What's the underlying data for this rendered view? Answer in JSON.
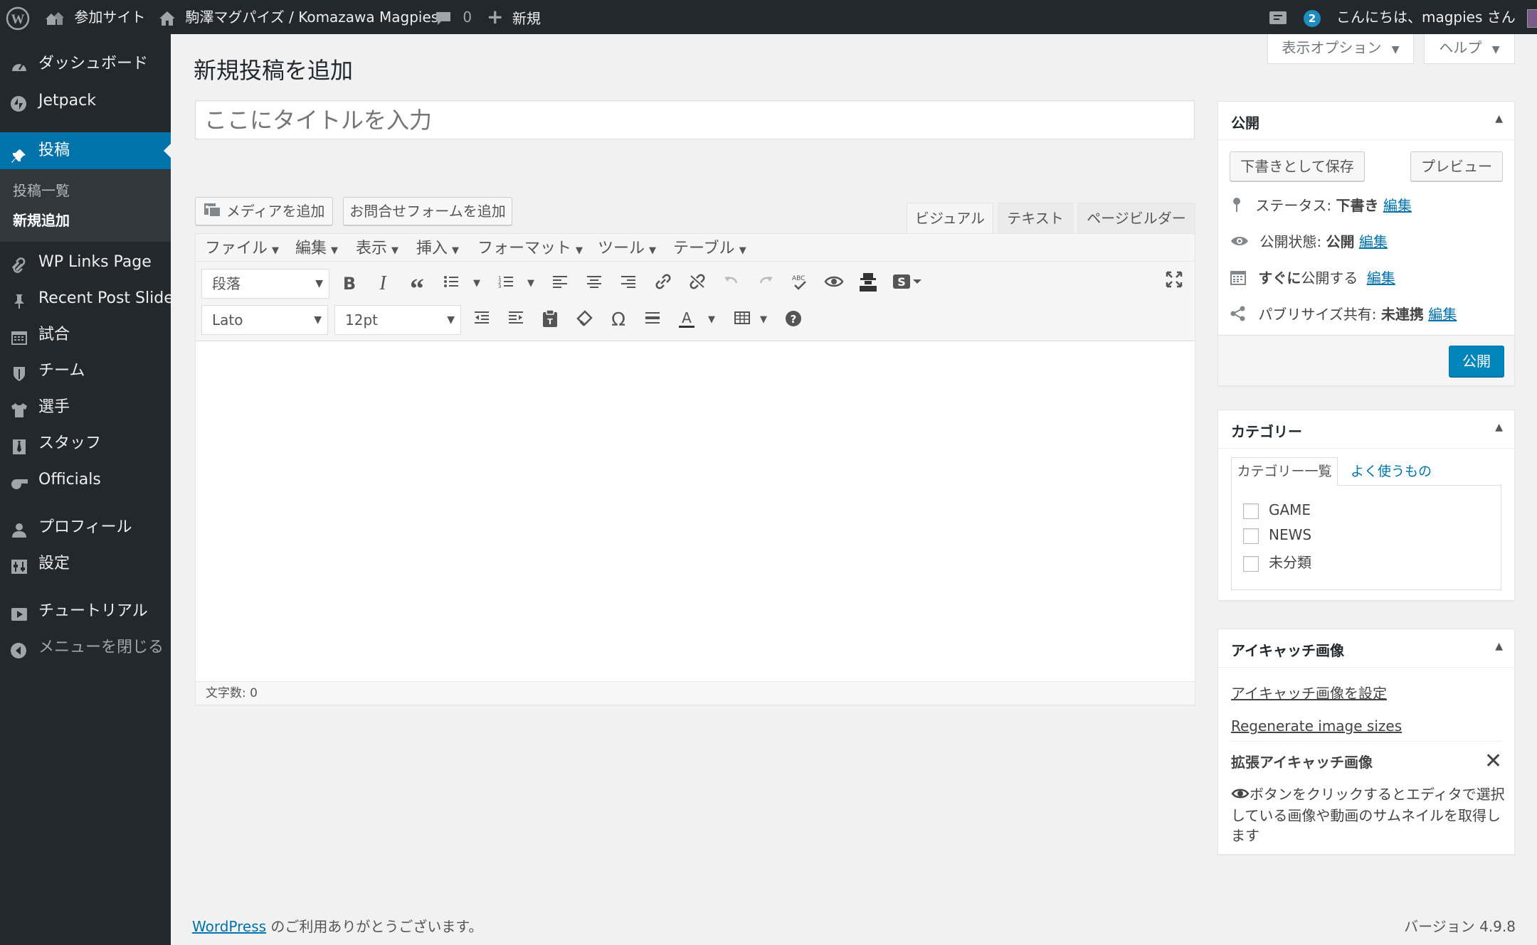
{
  "adminbar": {
    "site_name": "参加サイト",
    "site_title": "駒澤マグパイズ / Komazawa Magpies",
    "comments_count": "0",
    "new_label": "新規",
    "updates_count": "2",
    "greeting": "こんにちは、magpies さん"
  },
  "sidebar": {
    "items": [
      {
        "label": "ダッシュボード",
        "icon": "dashboard-icon"
      },
      {
        "label": "Jetpack",
        "icon": "jetpack-icon"
      },
      {
        "label": "投稿",
        "icon": "pin-icon"
      },
      {
        "label": "WP Links Page",
        "icon": "link-icon"
      },
      {
        "label": "Recent Post Slider",
        "icon": "pin-icon"
      },
      {
        "label": "試合",
        "icon": "calendar-icon"
      },
      {
        "label": "チーム",
        "icon": "shield-icon"
      },
      {
        "label": "選手",
        "icon": "shirt-icon"
      },
      {
        "label": "スタッフ",
        "icon": "tie-icon"
      },
      {
        "label": "Officials",
        "icon": "whistle-icon"
      },
      {
        "label": "プロフィール",
        "icon": "user-icon"
      },
      {
        "label": "設定",
        "icon": "settings-icon"
      },
      {
        "label": "チュートリアル",
        "icon": "video-icon"
      },
      {
        "label": "メニューを閉じる",
        "icon": "collapse-icon"
      }
    ],
    "submenu": [
      "投稿一覧",
      "新規追加"
    ]
  },
  "screen_options": {
    "options_label": "表示オプション",
    "help_label": "ヘルプ"
  },
  "page": {
    "title": "新規投稿を追加",
    "title_placeholder": "ここにタイトルを入力"
  },
  "editor": {
    "add_media": "メディアを追加",
    "add_form": "お問合せフォームを追加",
    "tabs": [
      "ビジュアル",
      "テキスト",
      "ページビルダー"
    ],
    "menu": [
      "ファイル",
      "編集",
      "表示",
      "挿入",
      "フォーマット",
      "ツール",
      "テーブル"
    ],
    "format_select": "段落",
    "font_select": "Lato",
    "size_select": "12pt",
    "word_count": "文字数: 0"
  },
  "publish": {
    "title": "公開",
    "save_draft": "下書きとして保存",
    "preview": "プレビュー",
    "status_label": "ステータス:",
    "status_value": "下書き",
    "visibility_label": "公開状態:",
    "visibility_value": "公開",
    "schedule_bold": "すぐに",
    "schedule_rest": "公開する",
    "publicize_label": "パブリサイズ共有:",
    "publicize_value": "未連携",
    "edit": "編集",
    "publish_button": "公開"
  },
  "categories": {
    "title": "カテゴリー",
    "tab_all": "カテゴリー一覧",
    "tab_popular": "よく使うもの",
    "items": [
      "GAME",
      "NEWS",
      "未分類"
    ]
  },
  "thumbnail": {
    "title": "アイキャッチ画像",
    "set_link": "アイキャッチ画像を設定",
    "regen_link": "Regenerate image sizes",
    "extended_title": "拡張アイキャッチ画像",
    "desc_line1": "ボタンをクリックするとエディタで選択",
    "desc_line2": "している画像や動画のサムネイルを取得し",
    "desc_line3": "ます"
  },
  "footer": {
    "wp_link": "WordPress",
    "thanks": "のご利用ありがとうございます。",
    "version": "バージョン 4.9.8"
  },
  "colors": {
    "adminbar": "#23282d",
    "accent": "#0073aa",
    "background": "#f1f1f1",
    "publish_button": "#0085ba"
  }
}
